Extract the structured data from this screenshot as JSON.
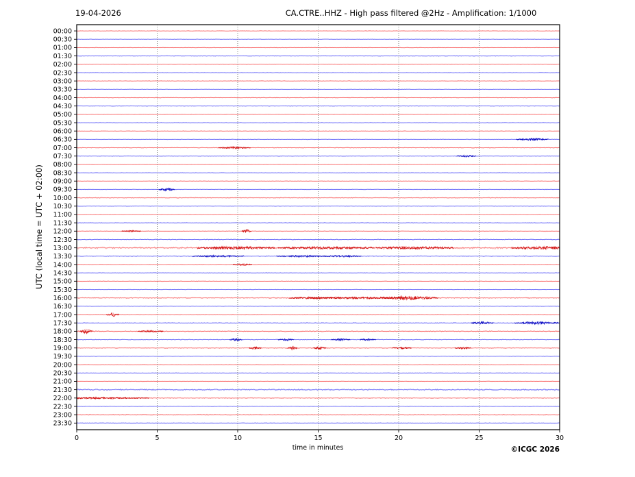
{
  "footer": {
    "copyright": "©ICGC 2026"
  },
  "chart_data": {
    "type": "line",
    "subtype": "helicorder-seismogram",
    "date": "19-04-2026",
    "title": "CA.CTRE..HHZ - High pass filtered @2Hz - Amplification: 1/1000",
    "ylabel": "UTC (local time = UTC + 02:00)",
    "xlabel": "time in minutes",
    "xlim": [
      0,
      30
    ],
    "xticks": [
      0,
      5,
      10,
      15,
      20,
      25,
      30
    ],
    "grid_minutes": [
      5,
      10,
      15,
      20,
      25
    ],
    "grid_on": true,
    "row_interval_minutes": 30,
    "colors": {
      "red_light": "#ff9999",
      "red_noise": "#ee3333",
      "red_event": "#cc0000",
      "blue_light": "#9999ff",
      "blue_noise": "#3333ee",
      "blue_event": "#0000bb",
      "grid": "#777777",
      "axis": "#000000",
      "background": "#ffffff"
    },
    "rows": [
      {
        "time": "00:00",
        "color": "red",
        "noise": 0.45,
        "events": []
      },
      {
        "time": "00:30",
        "color": "blue",
        "noise": 0.45,
        "events": []
      },
      {
        "time": "01:00",
        "color": "red",
        "noise": 0.5,
        "events": []
      },
      {
        "time": "01:30",
        "color": "blue",
        "noise": 0.55,
        "events": []
      },
      {
        "time": "02:00",
        "color": "red",
        "noise": 0.5,
        "events": []
      },
      {
        "time": "02:30",
        "color": "blue",
        "noise": 0.5,
        "events": []
      },
      {
        "time": "03:00",
        "color": "red",
        "noise": 0.5,
        "events": []
      },
      {
        "time": "03:30",
        "color": "blue",
        "noise": 0.45,
        "events": []
      },
      {
        "time": "04:00",
        "color": "red",
        "noise": 0.65,
        "events": []
      },
      {
        "time": "04:30",
        "color": "blue",
        "noise": 0.55,
        "events": []
      },
      {
        "time": "05:00",
        "color": "red",
        "noise": 0.5,
        "events": []
      },
      {
        "time": "05:30",
        "color": "blue",
        "noise": 0.5,
        "events": []
      },
      {
        "time": "06:00",
        "color": "red",
        "noise": 0.45,
        "events": []
      },
      {
        "time": "06:30",
        "color": "blue",
        "noise": 0.5,
        "events": [
          [
            28.3,
            0.5,
            1.1
          ]
        ]
      },
      {
        "time": "07:00",
        "color": "red",
        "noise": 0.7,
        "events": [
          [
            9.8,
            0.5,
            0.7
          ]
        ]
      },
      {
        "time": "07:30",
        "color": "blue",
        "noise": 0.55,
        "events": [
          [
            24.2,
            0.3,
            0.7
          ]
        ]
      },
      {
        "time": "08:00",
        "color": "red",
        "noise": 0.5,
        "events": []
      },
      {
        "time": "08:30",
        "color": "blue",
        "noise": 0.45,
        "events": []
      },
      {
        "time": "09:00",
        "color": "red",
        "noise": 0.45,
        "events": []
      },
      {
        "time": "09:30",
        "color": "blue",
        "noise": 0.5,
        "events": [
          [
            5.6,
            0.25,
            1.3
          ]
        ]
      },
      {
        "time": "10:00",
        "color": "red",
        "noise": 0.75,
        "events": []
      },
      {
        "time": "10:30",
        "color": "blue",
        "noise": 0.5,
        "events": []
      },
      {
        "time": "11:00",
        "color": "red",
        "noise": 0.5,
        "events": []
      },
      {
        "time": "11:30",
        "color": "blue",
        "noise": 0.6,
        "events": []
      },
      {
        "time": "12:00",
        "color": "red",
        "noise": 0.55,
        "events": [
          [
            3.4,
            0.3,
            0.5
          ],
          [
            10.55,
            0.15,
            1.2
          ]
        ]
      },
      {
        "time": "12:30",
        "color": "blue",
        "noise": 0.8,
        "events": []
      },
      {
        "time": "13:00",
        "color": "red",
        "noise": 1.5,
        "events": [
          [
            9.9,
            1.2,
            0.8
          ],
          [
            15.5,
            1.5,
            0.5
          ],
          [
            21.0,
            1.2,
            0.7
          ],
          [
            29.0,
            1.0,
            0.8
          ]
        ]
      },
      {
        "time": "13:30",
        "color": "blue",
        "noise": 0.85,
        "events": [
          [
            8.8,
            0.8,
            0.5
          ],
          [
            14.0,
            0.8,
            0.5
          ],
          [
            16.5,
            0.6,
            0.5
          ]
        ]
      },
      {
        "time": "14:00",
        "color": "red",
        "noise": 0.6,
        "events": [
          [
            10.3,
            0.3,
            0.7
          ]
        ]
      },
      {
        "time": "14:30",
        "color": "blue",
        "noise": 0.5,
        "events": []
      },
      {
        "time": "15:00",
        "color": "red",
        "noise": 0.55,
        "events": []
      },
      {
        "time": "15:30",
        "color": "blue",
        "noise": 0.55,
        "events": []
      },
      {
        "time": "16:00",
        "color": "red",
        "noise": 0.9,
        "events": [
          [
            14.8,
            0.8,
            0.6
          ],
          [
            17.5,
            1.5,
            0.6
          ],
          [
            20.7,
            0.9,
            1.4
          ]
        ]
      },
      {
        "time": "16:30",
        "color": "blue",
        "noise": 0.5,
        "events": []
      },
      {
        "time": "17:00",
        "color": "red",
        "noise": 0.6,
        "events": [
          [
            2.25,
            0.2,
            1.5
          ]
        ]
      },
      {
        "time": "17:30",
        "color": "blue",
        "noise": 0.7,
        "events": [
          [
            25.2,
            0.35,
            1.0
          ],
          [
            28.6,
            0.7,
            1.1
          ]
        ]
      },
      {
        "time": "18:00",
        "color": "red",
        "noise": 0.85,
        "events": [
          [
            0.6,
            0.2,
            1.7
          ],
          [
            4.6,
            0.4,
            0.5
          ]
        ]
      },
      {
        "time": "18:30",
        "color": "blue",
        "noise": 0.75,
        "events": [
          [
            9.9,
            0.2,
            1.0
          ],
          [
            13.0,
            0.25,
            0.8
          ],
          [
            16.4,
            0.3,
            0.7
          ],
          [
            18.1,
            0.25,
            0.7
          ]
        ]
      },
      {
        "time": "19:00",
        "color": "red",
        "noise": 0.75,
        "events": [
          [
            11.1,
            0.2,
            0.9
          ],
          [
            13.4,
            0.15,
            1.3
          ],
          [
            15.1,
            0.2,
            1.0
          ],
          [
            20.2,
            0.3,
            0.6
          ],
          [
            24.0,
            0.25,
            0.6
          ]
        ]
      },
      {
        "time": "19:30",
        "color": "blue",
        "noise": 0.5,
        "events": []
      },
      {
        "time": "20:00",
        "color": "red",
        "noise": 0.45,
        "events": []
      },
      {
        "time": "20:30",
        "color": "blue",
        "noise": 0.45,
        "events": []
      },
      {
        "time": "21:00",
        "color": "red",
        "noise": 0.45,
        "events": []
      },
      {
        "time": "21:30",
        "color": "blue",
        "noise": 1.3,
        "events": []
      },
      {
        "time": "22:00",
        "color": "red",
        "noise": 0.8,
        "events": [
          [
            1.5,
            1.5,
            0.5
          ]
        ]
      },
      {
        "time": "22:30",
        "color": "blue",
        "noise": 0.5,
        "events": []
      },
      {
        "time": "23:00",
        "color": "red",
        "noise": 0.8,
        "events": []
      },
      {
        "time": "23:30",
        "color": "blue",
        "noise": 0.5,
        "events": []
      }
    ]
  }
}
